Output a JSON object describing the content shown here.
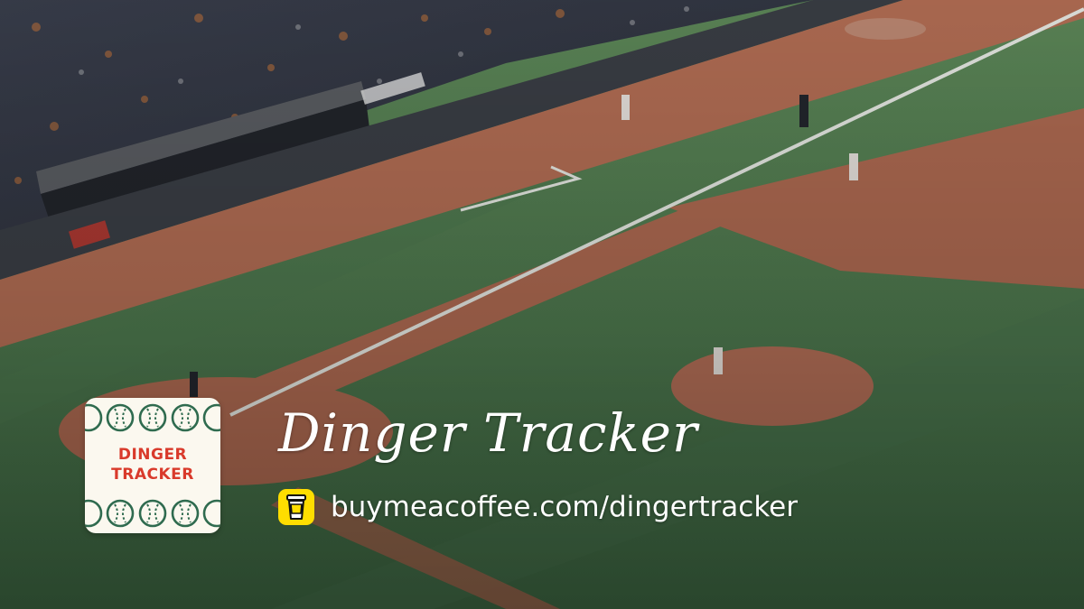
{
  "banner": {
    "title": "Dinger Tracker",
    "link_text": "buymeacoffee.com/dingertracker",
    "logo": {
      "line1": "DINGER",
      "line2": "TRACKER"
    },
    "link_icon": "coffee-cup-icon",
    "background": "baseball-stadium-field-photo"
  },
  "colors": {
    "logo_text": "#d93a2b",
    "logo_background": "#fbf8ef",
    "ball_stroke": "#2f6b4f",
    "coffee_badge": "#ffdd00",
    "text": "#ffffff"
  }
}
